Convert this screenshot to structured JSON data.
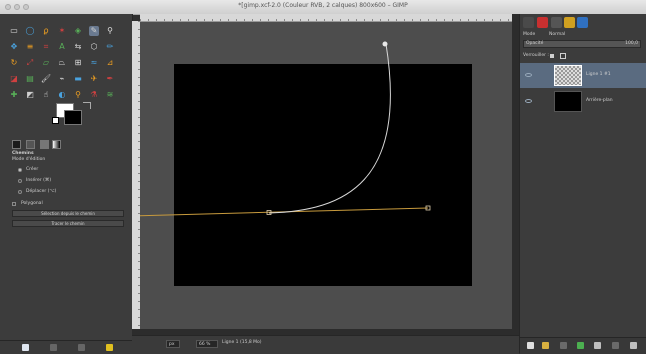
{
  "window": {
    "title": "*[gimp.xcf-2.0 (Couleur RVB, 2 calques) 800x600 – GIMP"
  },
  "toolbox": {
    "tool_icons": [
      "rect-select-icon",
      "ellipse-select-icon",
      "free-select-icon",
      "fuzzy-select-icon",
      "color-select-icon",
      "paths-icon",
      "clone-stamp-icon",
      "move-icon",
      "align-icon",
      "crop-icon",
      "text-icon",
      "flip-icon",
      "cage-transform-icon",
      "pencil-icon",
      "rotate-icon",
      "scale-icon",
      "shear-icon",
      "perspective-icon",
      "unified-transform-icon",
      "warp-transform-icon",
      "measure-icon",
      "bucket-fill-icon",
      "gradient-icon",
      "paintbrush-icon",
      "brush-icon",
      "eraser-icon",
      "airbrush-icon",
      "ink-icon",
      "heal-icon",
      "perspective-clone-icon",
      "smudge-icon",
      "dodge-icon",
      "zoom-icon",
      "color-picker-icon",
      "smudge2-icon"
    ],
    "active_tool": "paths-icon",
    "fg_color": "#ffffff",
    "bg_color": "#000000",
    "options": {
      "title": "Chemins",
      "mode_label": "Mode d'édition",
      "modes": [
        "Créer",
        "Insérer (⌘)",
        "Déplacer (⌥)"
      ],
      "selected_mode": 0,
      "polygon_label": "Polygonal",
      "btn_selection": "Sélection depuis le chemin",
      "btn_stroke": "Tracer le chemin"
    }
  },
  "canvas": {
    "image_bg": "#000000",
    "area_bg": "#4d4d4d",
    "curve_color": "#d8d8d8",
    "path_color": "#c79a3d"
  },
  "statusbar": {
    "unit": "px",
    "zoom": "66 %",
    "info": "Ligne 1 (15,8 Mo)"
  },
  "dock": {
    "mode_label": "Mode",
    "mode_value": "Normal",
    "opacity_label": "Opacité",
    "opacity_value": "100,0",
    "lock_label": "Verrouiller :",
    "layers": [
      {
        "name": "Ligne 1 #1",
        "selected": true,
        "thumb": "transparent"
      },
      {
        "name": "Arrière-plan",
        "selected": false,
        "thumb": "#000000"
      }
    ]
  }
}
